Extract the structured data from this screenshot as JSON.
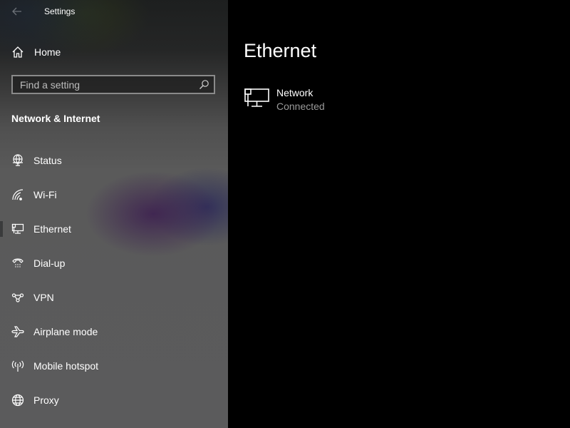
{
  "window": {
    "title": "Settings",
    "back_icon": "back-arrow-icon"
  },
  "sidebar": {
    "home": {
      "label": "Home",
      "icon": "home-icon"
    },
    "search": {
      "placeholder": "Find a setting",
      "value": "",
      "icon": "search-icon"
    },
    "section_title": "Network & Internet",
    "selected": "Ethernet",
    "items": [
      {
        "label": "Status",
        "icon": "status-globe-monitor-icon"
      },
      {
        "label": "Wi-Fi",
        "icon": "wifi-icon"
      },
      {
        "label": "Ethernet",
        "icon": "ethernet-icon"
      },
      {
        "label": "Dial-up",
        "icon": "dialup-phone-icon"
      },
      {
        "label": "VPN",
        "icon": "vpn-icon"
      },
      {
        "label": "Airplane mode",
        "icon": "airplane-icon"
      },
      {
        "label": "Mobile hotspot",
        "icon": "hotspot-icon"
      },
      {
        "label": "Proxy",
        "icon": "globe-icon"
      }
    ]
  },
  "main": {
    "title": "Ethernet",
    "networks": [
      {
        "name": "Network",
        "status": "Connected",
        "icon": "ethernet-network-icon"
      }
    ]
  }
}
